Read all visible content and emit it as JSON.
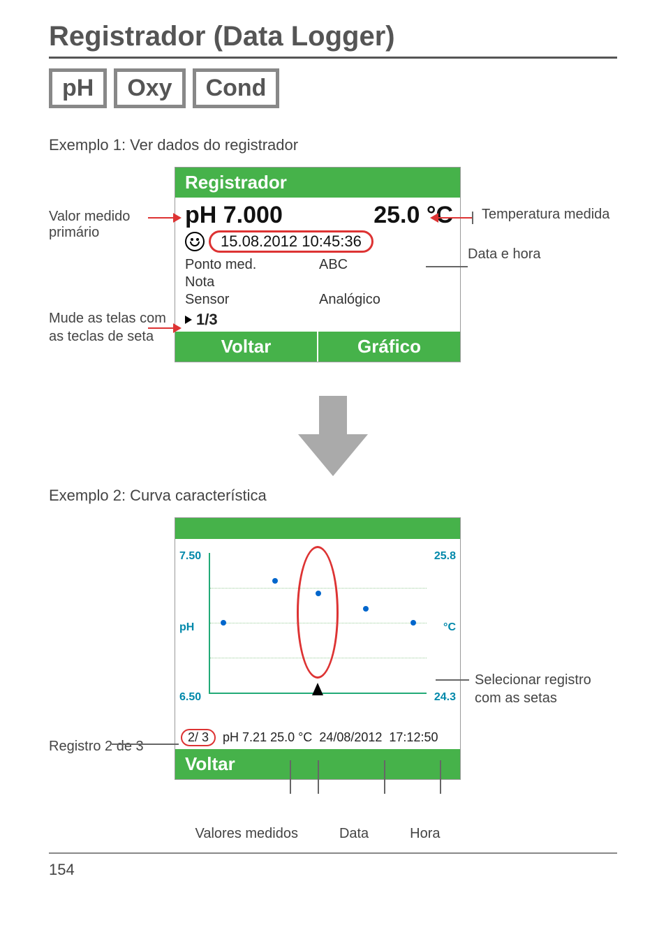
{
  "page_title": "Registrador (Data Logger)",
  "tags": [
    "pH",
    "Oxy",
    "Cond"
  ],
  "example1": {
    "label": "Exemplo 1: Ver dados do registrador",
    "callout_primary": "Valor medido primário",
    "callout_switch": "Mude as telas com as teclas de seta",
    "callout_temp": "Temperatura medida",
    "callout_datetime": "Data e hora",
    "device": {
      "header": "Registrador",
      "main_value": "pH 7.000",
      "temp_value": "25.0 °C",
      "datetime": "15.08.2012  10:45:36",
      "row_left_1": "Ponto med.",
      "row_right_1": "ABC",
      "row_left_2": "Nota",
      "row_left_3": "Sensor",
      "row_right_3": "Analógico",
      "page_indicator": "1/3",
      "btn_back": "Voltar",
      "btn_graph": "Gráfico"
    }
  },
  "example2": {
    "label": "Exemplo 2: Curva característica",
    "callout_record": "Registro 2 de 3",
    "callout_select": "Selecionar registro com as setas",
    "callout_values": "Valores medidos",
    "callout_date": "Data",
    "callout_time": "Hora",
    "graph": {
      "y_top_left": "7.50",
      "y_bot_left": "6.50",
      "y_mid_left": "pH",
      "y_top_right": "25.8",
      "y_bot_right": "24.3",
      "y_mid_right": "°C",
      "record_badge": "2/ 3",
      "status_values": "pH 7.21 25.0 °C",
      "status_date": "24/08/2012",
      "status_time": "17:12:50",
      "btn_back": "Voltar"
    }
  },
  "chart_data": {
    "type": "line",
    "series": [
      {
        "name": "pH",
        "axis": "left",
        "values": [
          7.0,
          7.3,
          7.21,
          7.1,
          7.0
        ]
      },
      {
        "name": "°C",
        "axis": "right",
        "values": [
          25.0,
          25.0,
          25.0,
          25.0,
          25.0
        ]
      }
    ],
    "x_index": [
      1,
      2,
      3,
      4,
      5
    ],
    "ylim_left": [
      6.5,
      7.5
    ],
    "ylim_right": [
      24.3,
      25.8
    ],
    "selected_index": 3,
    "selected_readout": {
      "pH": 7.21,
      "tempC": 25.0,
      "date": "24/08/2012",
      "time": "17:12:50"
    },
    "title": "",
    "xlabel": "",
    "ylabel_left": "pH",
    "ylabel_right": "°C"
  },
  "page_number": "154"
}
